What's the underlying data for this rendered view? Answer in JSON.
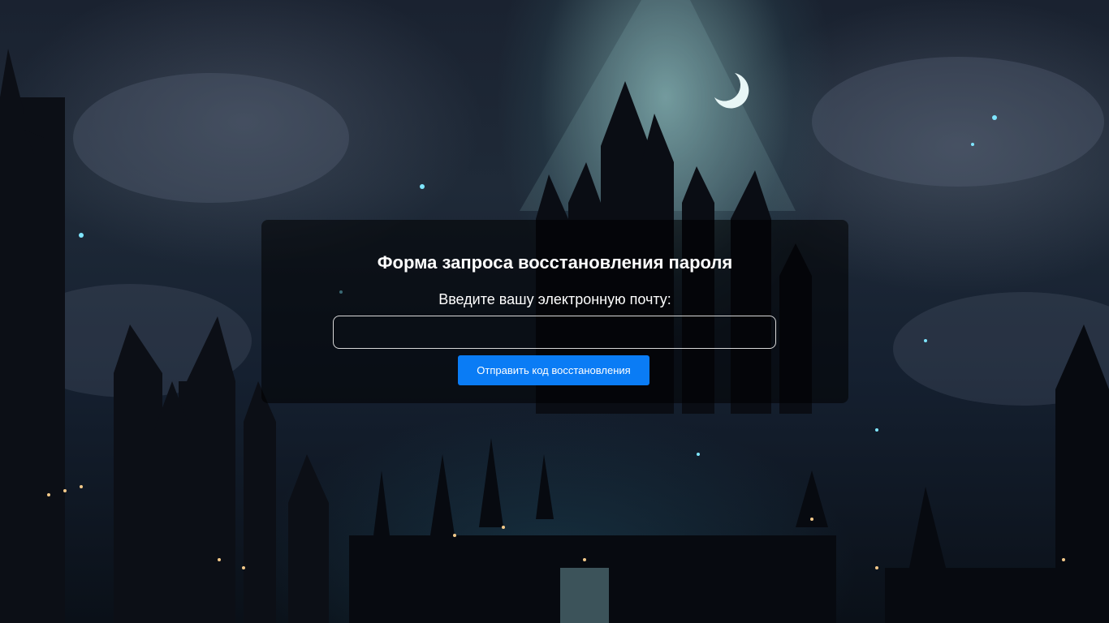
{
  "background": {
    "description_icon": "dark-fantasy-castle-background",
    "colors": {
      "sky": "#1f2a38",
      "glow": "#aae6e1",
      "night": "#0a1018"
    }
  },
  "form": {
    "title": "Форма запроса восстановления пароля",
    "email_label": "Введите вашу электронную почту:",
    "email_value": "",
    "email_placeholder": "",
    "submit_label": "Отправить код восстановления",
    "accent_color": "#0a7cf5"
  }
}
